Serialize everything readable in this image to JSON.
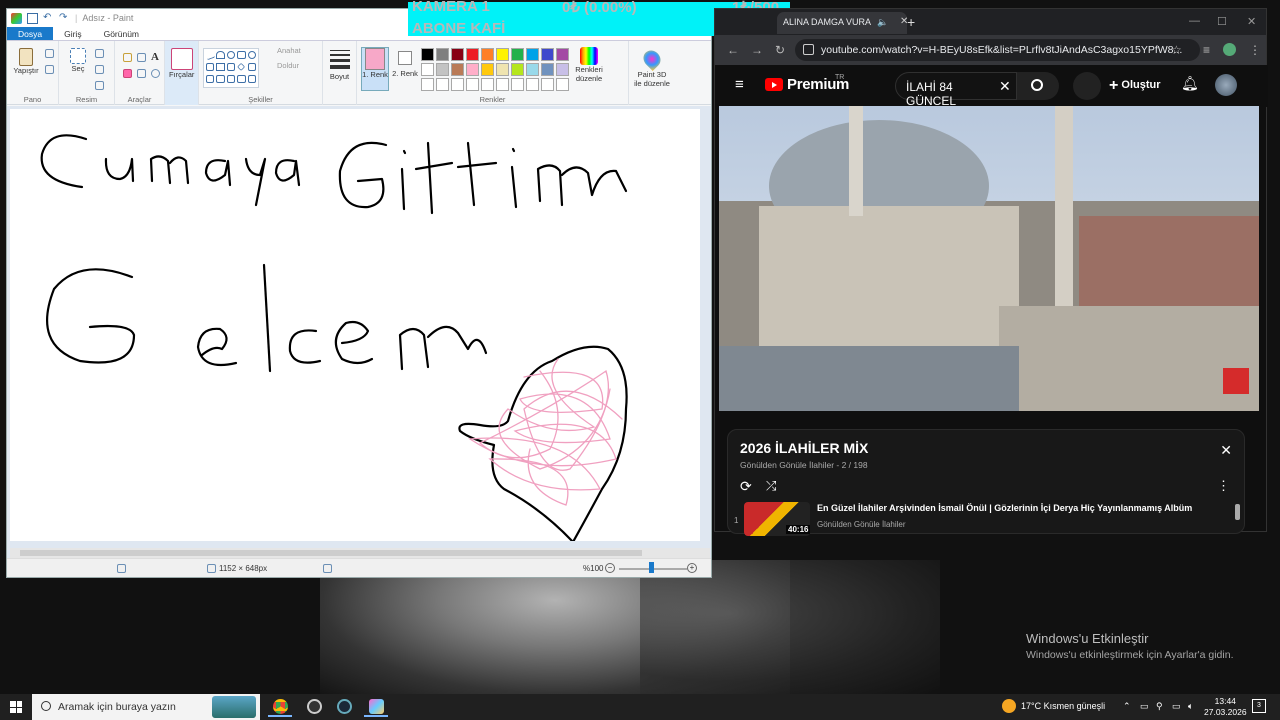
{
  "overlay": {
    "line1_left": "KAMERA 1",
    "line1_mid": "0₺ (0.00%)",
    "line1_right": "1₺/500",
    "line2": "ABONE KAFİ"
  },
  "paint": {
    "title": "Adsız - Paint",
    "tabs": [
      "Dosya",
      "Giriş",
      "Görünüm"
    ],
    "groups": {
      "clipboard": "Pano",
      "image": "Resim",
      "tools": "Araçlar",
      "shapes": "Şekiller",
      "colors": "Renkler"
    },
    "buttons": {
      "paste": "Yapıştır",
      "select": "Seç",
      "brushes": "Fırçalar",
      "outline": "Anahat",
      "fill": "Doldur",
      "size": "Boyut",
      "color1": "1. Renk",
      "color2": "2. Renk",
      "edit_colors": "Renkleri düzenle",
      "paint3d": "Paint 3D ile düzenle"
    },
    "palette": [
      "#000000",
      "#7f7f7f",
      "#880015",
      "#ed1c24",
      "#ff7f27",
      "#fff200",
      "#22b14c",
      "#00a2e8",
      "#3f48cc",
      "#a349a4",
      "#ffffff",
      "#c3c3c3",
      "#b97a57",
      "#ffaec9",
      "#ffc90e",
      "#efe4b0",
      "#b5e61d",
      "#99d9ea",
      "#7092be",
      "#c8bfe7",
      "#ffffff",
      "#ffffff",
      "#ffffff",
      "#ffffff",
      "#ffffff",
      "#ffffff",
      "#ffffff",
      "#ffffff",
      "#ffffff",
      "#ffffff"
    ],
    "color1": "#f7a8c8",
    "color2": "#ffffff",
    "canvas_dims": "1152 × 648px",
    "zoom": "%100",
    "drawing_text": [
      "Cumaya Gittim",
      "Gelcem"
    ],
    "heart_fill": "#f0a0c0"
  },
  "chrome": {
    "tab_title": "ALINA DAMGA VURA",
    "url": "youtube.com/watch?v=H-BEyU8sEfk&list=PLrflv8tJiAndAsC3agxo15YPfW8...",
    "youtube": {
      "brand": "Premium",
      "region": "TR",
      "search_value": "İLAHİ 84 GÜNCEL",
      "create": "Oluştur",
      "playlist_title": "2026 İLAHİLER MİX",
      "playlist_sub": "Gönülden Gönüle İlahiler - 2 / 198",
      "item_index": "1",
      "item_title": "En Güzel İlahiler Arşivinden İsmail Önül | Gözlerinin İçi Derya Hiç Yayınlanmamış Albüm",
      "item_channel": "Gönülden Gönüle İlahiler",
      "item_duration": "40:16"
    }
  },
  "desktop": {
    "activate_title": "Windows'u Etkinleştir",
    "activate_sub": "Windows'u etkinleştirmek için Ayarlar'a gidin."
  },
  "taskbar": {
    "search_placeholder": "Aramak için buraya yazın",
    "weather": "17°C  Kısmen güneşli",
    "time": "13:44",
    "date": "27.03.2026",
    "notif_count": "3"
  }
}
